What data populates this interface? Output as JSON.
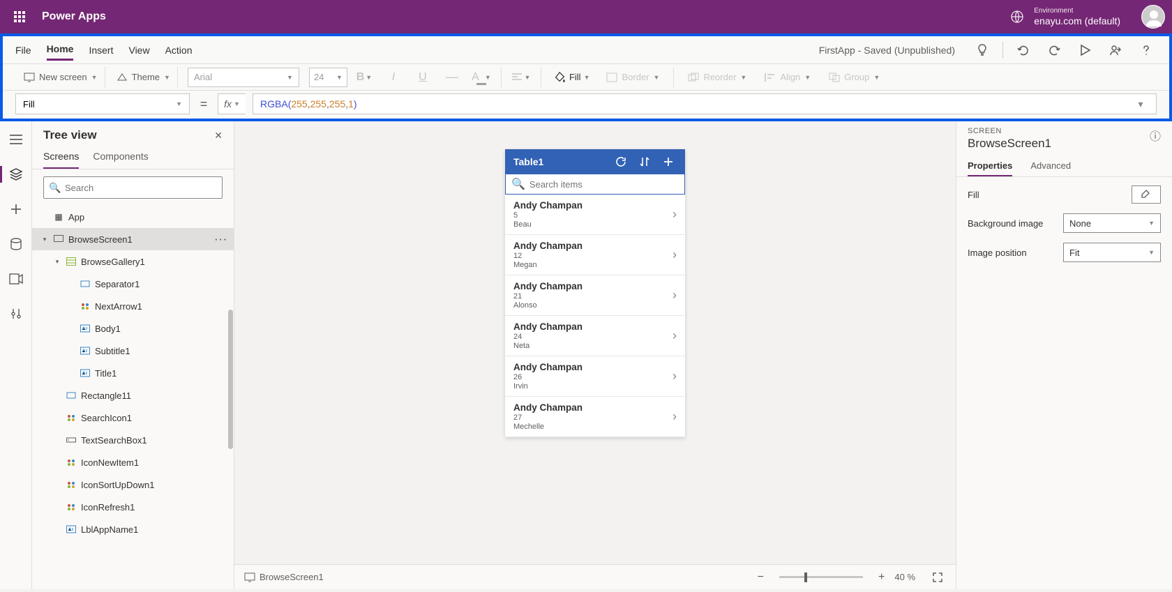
{
  "header": {
    "app_title": "Power Apps",
    "env_label": "Environment",
    "env_value": "enayu.com (default)"
  },
  "ribbon": {
    "tabs": [
      "File",
      "Home",
      "Insert",
      "View",
      "Action"
    ],
    "active_tab": "Home",
    "doc_status": "FirstApp - Saved (Unpublished)",
    "new_screen": "New screen",
    "theme": "Theme",
    "font": "Arial",
    "size": "24",
    "fill": "Fill",
    "border": "Border",
    "reorder": "Reorder",
    "align": "Align",
    "group": "Group"
  },
  "formula": {
    "property": "Fill",
    "fx": "fx",
    "fn": "RGBA",
    "args": [
      "255",
      "255",
      "255",
      "1"
    ]
  },
  "tree": {
    "title": "Tree view",
    "tabs": [
      "Screens",
      "Components"
    ],
    "active_tab": "Screens",
    "search_placeholder": "Search",
    "app": "App",
    "items": [
      {
        "name": "BrowseScreen1",
        "icon": "screen",
        "level": 1,
        "expanded": true,
        "selected": true
      },
      {
        "name": "BrowseGallery1",
        "icon": "gallery",
        "level": 2,
        "expanded": true
      },
      {
        "name": "Separator1",
        "icon": "rect",
        "level": 3
      },
      {
        "name": "NextArrow1",
        "icon": "ctrl",
        "level": 3
      },
      {
        "name": "Body1",
        "icon": "label",
        "level": 3
      },
      {
        "name": "Subtitle1",
        "icon": "label",
        "level": 3
      },
      {
        "name": "Title1",
        "icon": "label",
        "level": 3
      },
      {
        "name": "Rectangle11",
        "icon": "rect",
        "level": "3b"
      },
      {
        "name": "SearchIcon1",
        "icon": "ctrl",
        "level": "3b"
      },
      {
        "name": "TextSearchBox1",
        "icon": "input",
        "level": "3b"
      },
      {
        "name": "IconNewItem1",
        "icon": "ctrl",
        "level": "3b"
      },
      {
        "name": "IconSortUpDown1",
        "icon": "ctrl",
        "level": "3b"
      },
      {
        "name": "IconRefresh1",
        "icon": "ctrl",
        "level": "3b"
      },
      {
        "name": "LblAppName1",
        "icon": "label",
        "level": "3b"
      }
    ]
  },
  "canvas": {
    "table_title": "Table1",
    "search_ph": "Search items",
    "gallery": [
      {
        "title": "Andy Champan",
        "sub1": "5",
        "sub2": "Beau"
      },
      {
        "title": "Andy Champan",
        "sub1": "12",
        "sub2": "Megan"
      },
      {
        "title": "Andy Champan",
        "sub1": "21",
        "sub2": "Alonso"
      },
      {
        "title": "Andy Champan",
        "sub1": "24",
        "sub2": "Neta"
      },
      {
        "title": "Andy Champan",
        "sub1": "26",
        "sub2": "Irvin"
      },
      {
        "title": "Andy Champan",
        "sub1": "27",
        "sub2": "Mechelle"
      }
    ],
    "footer_screen": "BrowseScreen1",
    "zoom": "40",
    "zoom_suffix": " %"
  },
  "properties": {
    "category": "SCREEN",
    "name": "BrowseScreen1",
    "tabs": [
      "Properties",
      "Advanced"
    ],
    "active_tab": "Properties",
    "fill_label": "Fill",
    "bg_label": "Background image",
    "bg_value": "None",
    "pos_label": "Image position",
    "pos_value": "Fit"
  }
}
